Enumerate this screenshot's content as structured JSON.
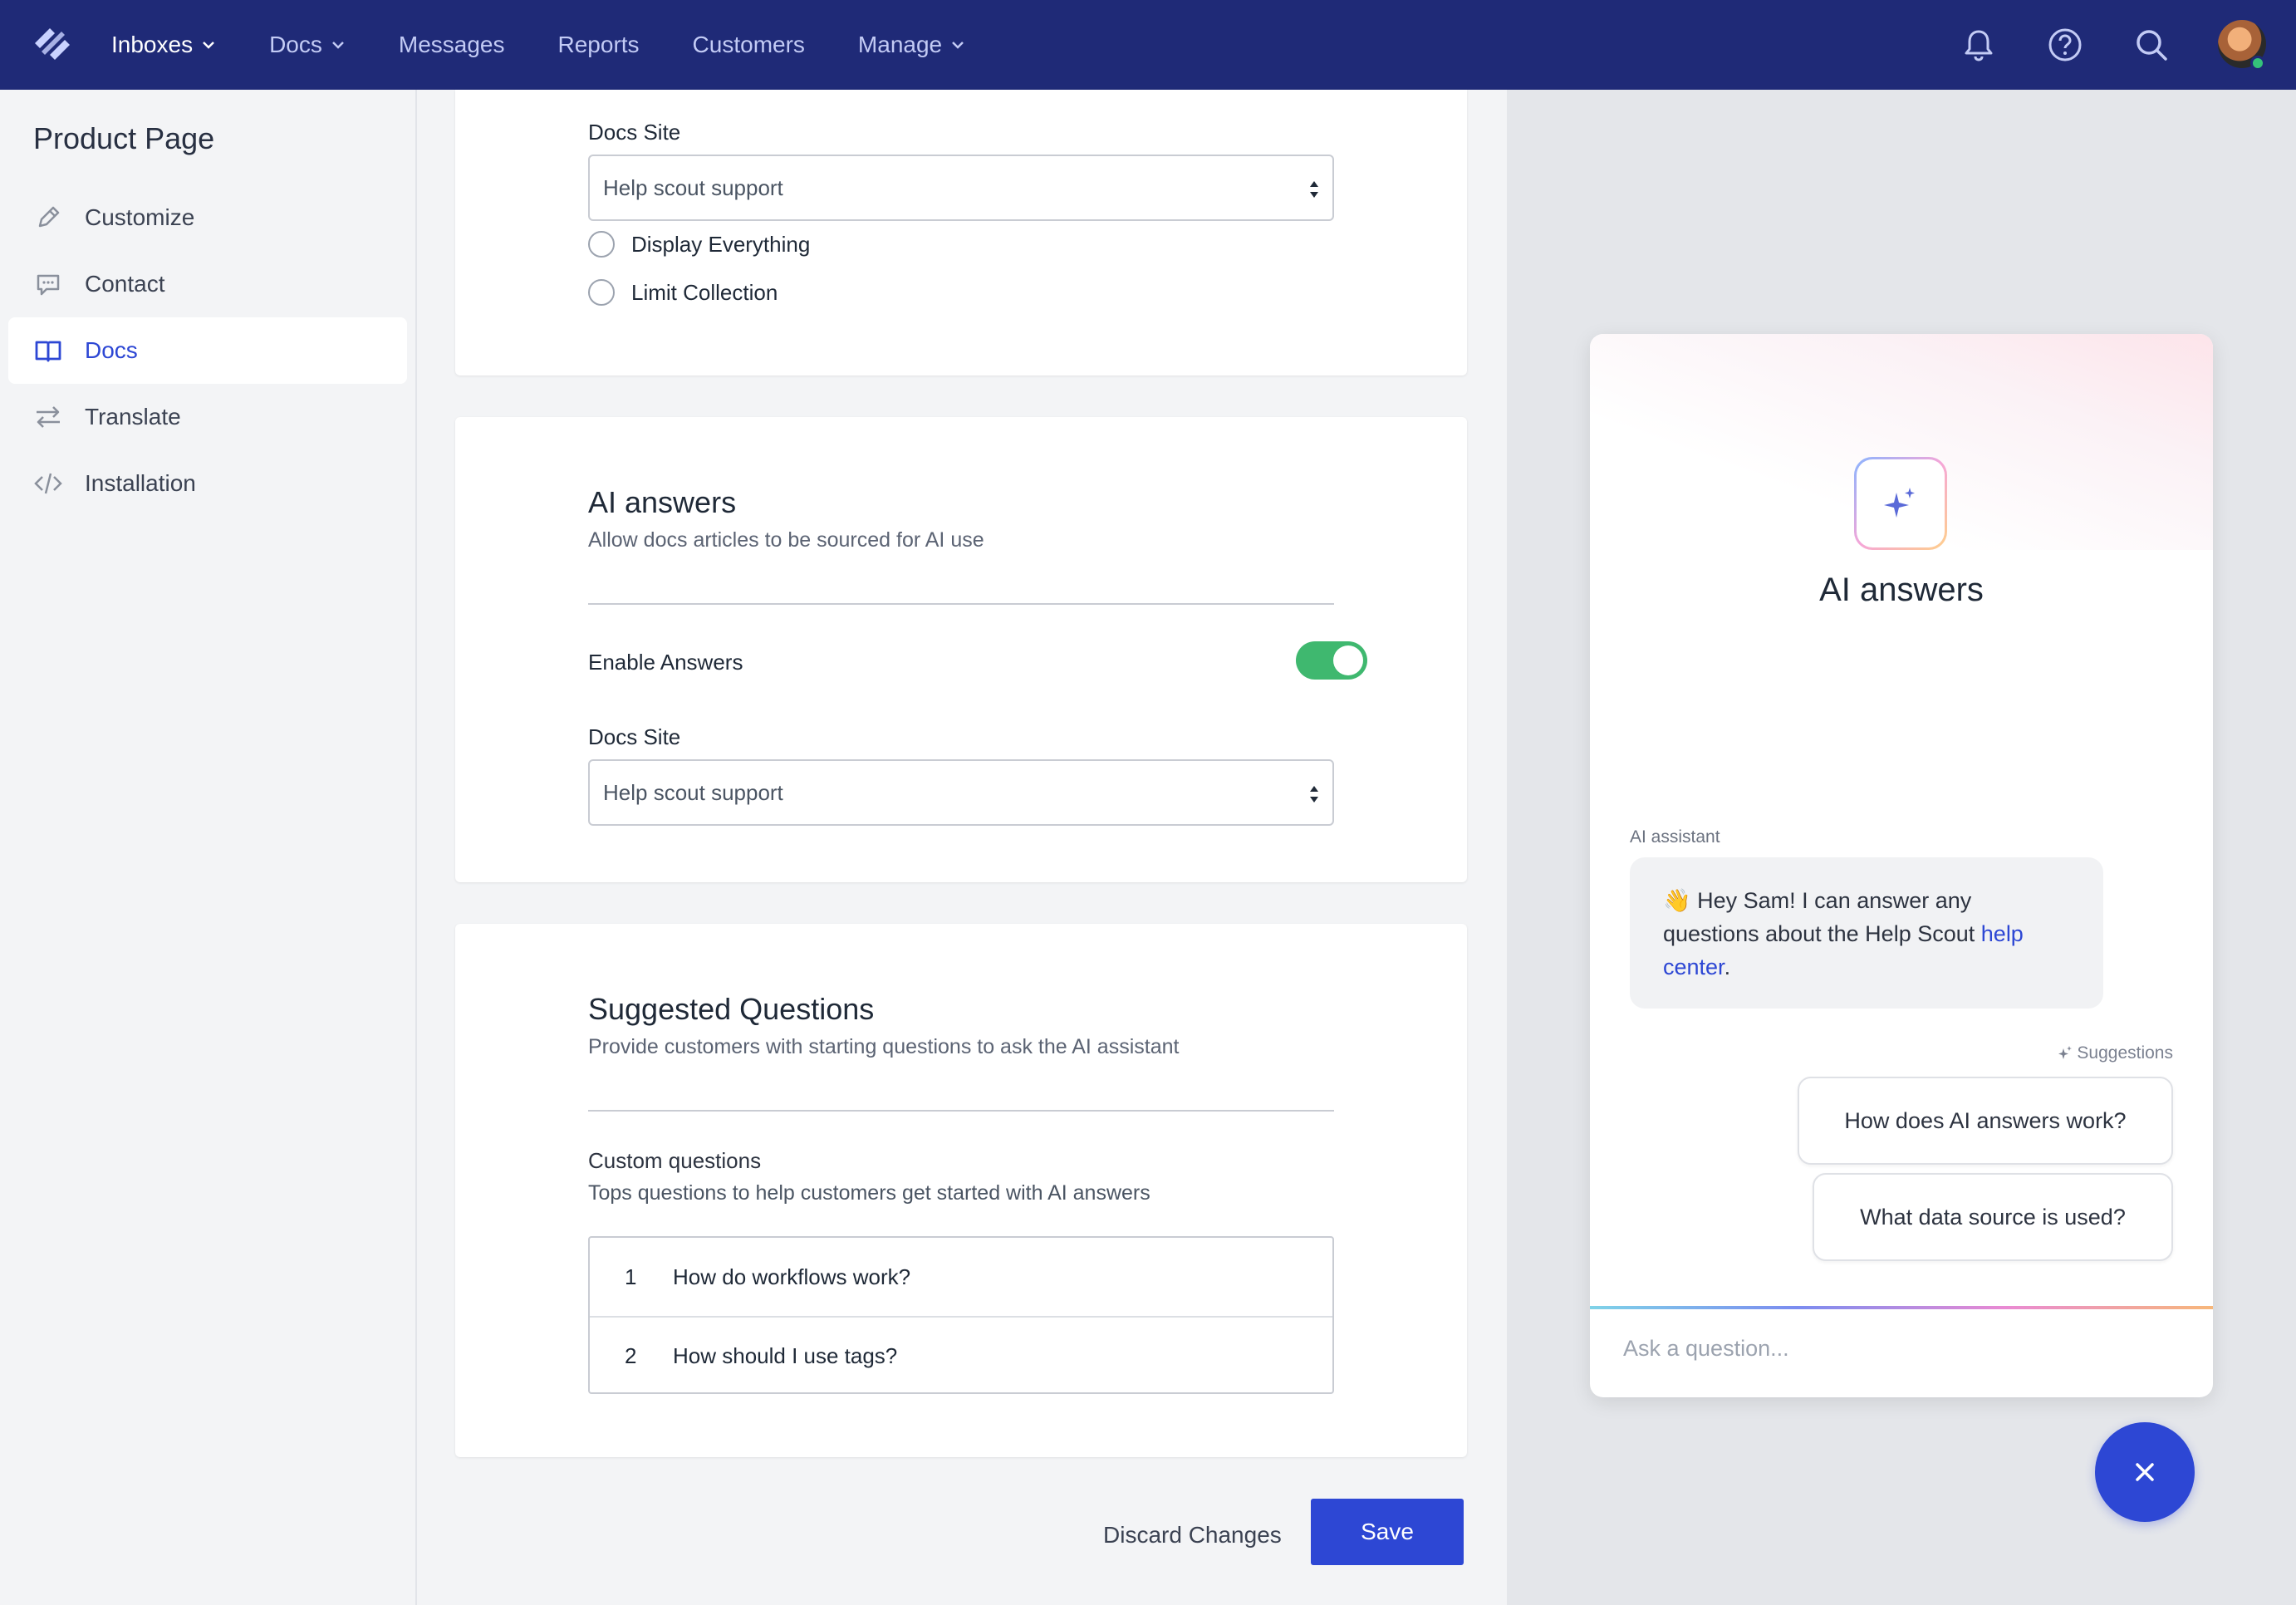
{
  "nav": {
    "items": [
      {
        "label": "Inboxes",
        "dropdown": true,
        "active": true
      },
      {
        "label": "Docs",
        "dropdown": true
      },
      {
        "label": "Messages"
      },
      {
        "label": "Reports"
      },
      {
        "label": "Customers"
      },
      {
        "label": "Manage",
        "dropdown": true
      }
    ],
    "icons": [
      "bell-icon",
      "help-icon",
      "search-icon"
    ],
    "colors": {
      "background": "#1f2a77",
      "active_text": "#ffffff",
      "inactive_text": "#c3cbf5"
    }
  },
  "sidebar": {
    "title": "Product Page",
    "items": [
      {
        "label": "Customize",
        "icon": "pencil-icon"
      },
      {
        "label": "Contact",
        "icon": "chat-bubble-icon"
      },
      {
        "label": "Docs",
        "icon": "book-icon",
        "active": true
      },
      {
        "label": "Translate",
        "icon": "arrows-swap-icon"
      },
      {
        "label": "Installation",
        "icon": "code-icon"
      }
    ]
  },
  "docs_card": {
    "docs_site_label": "Docs Site",
    "docs_site_value": "Help scout support",
    "radio_options": [
      "Display Everything",
      "Limit Collection"
    ]
  },
  "ai_card": {
    "title": "AI answers",
    "subtitle": "Allow docs articles to be sourced for AI use",
    "enable_label": "Enable Answers",
    "enabled": true,
    "docs_site_label": "Docs Site",
    "docs_site_value": "Help scout support"
  },
  "questions_card": {
    "title": "Suggested Questions",
    "subtitle": "Provide customers with starting questions to ask the AI assistant",
    "custom_label": "Custom questions",
    "custom_sub": "Tops questions to help customers get started with AI answers",
    "questions": [
      {
        "num": "1",
        "text": "How do workflows work?"
      },
      {
        "num": "2",
        "text": "How should I use tags?"
      }
    ]
  },
  "actions": {
    "discard": "Discard Changes",
    "save": "Save"
  },
  "widget": {
    "title": "AI answers",
    "assistant_label": "AI assistant",
    "greeting_emoji": "👋",
    "greeting_text": "Hey Sam! I can answer any questions about the Help Scout",
    "greeting_link": "help center",
    "greeting_end": ".",
    "suggestions_label": "Suggestions",
    "suggestions": [
      "How does AI answers work?",
      "What data source is used?"
    ],
    "input_placeholder": "Ask a question..."
  },
  "colors": {
    "accent": "#2d47d4",
    "toggle_on": "#3fb86f"
  }
}
